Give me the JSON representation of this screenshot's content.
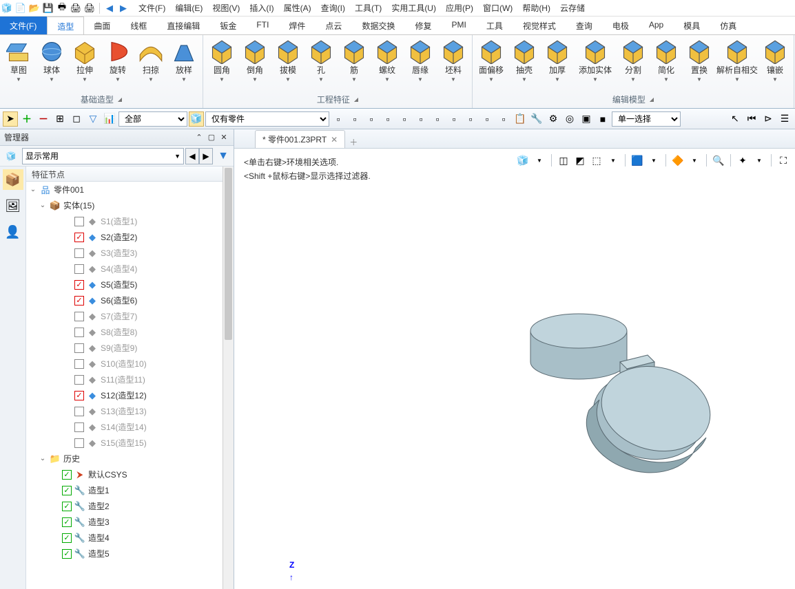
{
  "menubar": {
    "items": [
      "文件(F)",
      "编辑(E)",
      "视图(V)",
      "插入(I)",
      "属性(A)",
      "查询(I)",
      "工具(T)",
      "实用工具(U)",
      "应用(P)",
      "窗口(W)",
      "帮助(H)",
      "云存储"
    ]
  },
  "qat": {
    "icons": [
      "app",
      "new",
      "open",
      "save",
      "print",
      "print-preview",
      "print-setup",
      "undo",
      "redo"
    ]
  },
  "ribbon": {
    "file_tab": "文件(F)",
    "tabs": [
      "造型",
      "曲面",
      "线框",
      "直接编辑",
      "钣金",
      "FTI",
      "焊件",
      "点云",
      "数据交换",
      "修复",
      "PMI",
      "工具",
      "视觉样式",
      "查询",
      "电极",
      "App",
      "模具",
      "仿真"
    ],
    "active_tab": "造型",
    "groups": [
      {
        "label": "基础造型",
        "tools": [
          "草图",
          "球体",
          "拉伸",
          "旋转",
          "扫掠",
          "放样"
        ]
      },
      {
        "label": "工程特征",
        "tools": [
          "圆角",
          "倒角",
          "拔模",
          "孔",
          "筋",
          "螺纹",
          "唇缘",
          "坯料"
        ]
      },
      {
        "label": "编辑模型",
        "tools": [
          "面偏移",
          "抽壳",
          "加厚",
          "添加实体",
          "分割",
          "简化",
          "置换",
          "解析自相交",
          "镶嵌"
        ]
      }
    ]
  },
  "toolbar2": {
    "select_mode": "全部",
    "filter_mode": "仅有零件",
    "pick_mode": "单一选择"
  },
  "manager": {
    "title": "管理器",
    "display_mode": "显示常用",
    "tree_header": "特征节点",
    "root": "零件001",
    "solids_label": "实体(15)",
    "solids": [
      {
        "label": "S1(造型1)",
        "checked": false
      },
      {
        "label": "S2(造型2)",
        "checked": true
      },
      {
        "label": "S3(造型3)",
        "checked": false
      },
      {
        "label": "S4(造型4)",
        "checked": false
      },
      {
        "label": "S5(造型5)",
        "checked": true
      },
      {
        "label": "S6(造型6)",
        "checked": true
      },
      {
        "label": "S7(造型7)",
        "checked": false
      },
      {
        "label": "S8(造型8)",
        "checked": false
      },
      {
        "label": "S9(造型9)",
        "checked": false
      },
      {
        "label": "S10(造型10)",
        "checked": false
      },
      {
        "label": "S11(造型11)",
        "checked": false
      },
      {
        "label": "S12(造型12)",
        "checked": true
      },
      {
        "label": "S13(造型13)",
        "checked": false
      },
      {
        "label": "S14(造型14)",
        "checked": false
      },
      {
        "label": "S15(造型15)",
        "checked": false
      }
    ],
    "history_label": "历史",
    "history": [
      {
        "label": "默认CSYS",
        "checked": true
      },
      {
        "label": "造型1",
        "checked": true
      },
      {
        "label": "造型2",
        "checked": true
      },
      {
        "label": "造型3",
        "checked": true
      },
      {
        "label": "造型4",
        "checked": true
      },
      {
        "label": "造型5",
        "checked": true
      }
    ]
  },
  "viewport": {
    "tab": "* 零件001.Z3PRT",
    "hint1": "<单击右键>环境相关选项.",
    "hint2": "<Shift +鼠标右键>显示选择过滤器.",
    "axis": "Z"
  }
}
